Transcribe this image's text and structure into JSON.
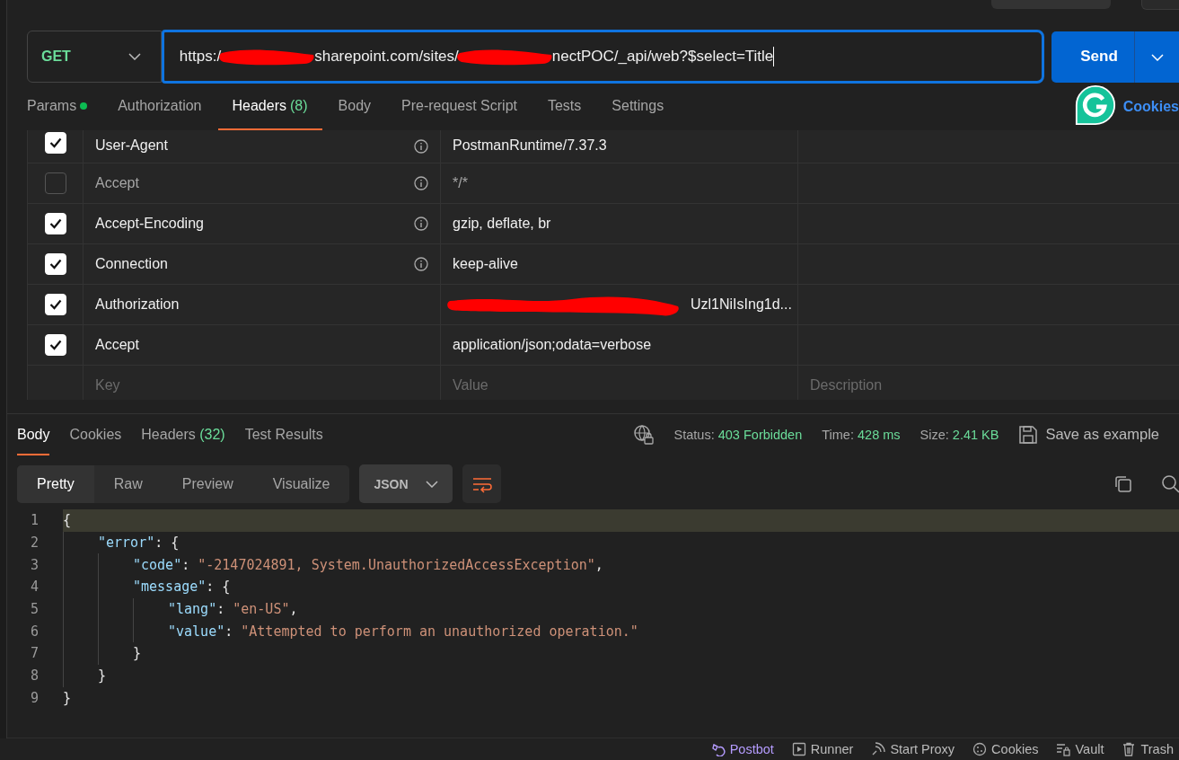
{
  "request": {
    "method": "GET",
    "url_parts": [
      {
        "kind": "text",
        "text": "https:/"
      },
      {
        "kind": "redacted"
      },
      {
        "kind": "text",
        "text": "sharepoint.com/sites/"
      },
      {
        "kind": "redacted"
      },
      {
        "kind": "text",
        "text": "nectPOC/_api/web?$select=Title"
      }
    ],
    "send_label": "Send"
  },
  "request_tabs": [
    {
      "label": "Params",
      "dot": true,
      "selected": false
    },
    {
      "label": "Authorization",
      "dot": false,
      "selected": false
    },
    {
      "label": "Headers",
      "count": "(8)",
      "dot": false,
      "selected": true
    },
    {
      "label": "Body",
      "dot": false,
      "selected": false
    },
    {
      "label": "Pre-request Script",
      "dot": false,
      "selected": false
    },
    {
      "label": "Tests",
      "dot": false,
      "selected": false
    },
    {
      "label": "Settings",
      "dot": false,
      "selected": false
    }
  ],
  "cookies_link": "Cookies",
  "headers": [
    {
      "checked": true,
      "key": "User-Agent",
      "info": true,
      "value": "PostmanRuntime/7.37.3",
      "redacted": false
    },
    {
      "checked": false,
      "key": "Accept",
      "info": true,
      "value": "*/*",
      "redacted": false
    },
    {
      "checked": true,
      "key": "Accept-Encoding",
      "info": true,
      "value": "gzip, deflate, br",
      "redacted": false
    },
    {
      "checked": true,
      "key": "Connection",
      "info": true,
      "value": "keep-alive",
      "redacted": false
    },
    {
      "checked": true,
      "key": "Authorization",
      "info": false,
      "value": "Uzl1NiIsIng1d...",
      "redacted": true
    },
    {
      "checked": true,
      "key": "Accept",
      "info": false,
      "value": "application/json;odata=verbose",
      "redacted": false
    }
  ],
  "new_header": {
    "key_placeholder": "Key",
    "value_placeholder": "Value",
    "description_placeholder": "Description"
  },
  "response_tabs": [
    {
      "label": "Body",
      "selected": true
    },
    {
      "label": "Cookies",
      "selected": false
    },
    {
      "label": "Headers",
      "count": "(32)",
      "selected": false
    },
    {
      "label": "Test Results",
      "selected": false
    }
  ],
  "response_meta": [
    {
      "label": "Status:",
      "value": "403 Forbidden"
    },
    {
      "label": "Time:",
      "value": "428 ms"
    },
    {
      "label": "Size:",
      "value": "2.41 KB"
    }
  ],
  "save_example": "Save as example",
  "view_modes": [
    {
      "label": "Pretty",
      "selected": true
    },
    {
      "label": "Raw",
      "selected": false
    },
    {
      "label": "Preview",
      "selected": false
    },
    {
      "label": "Visualize",
      "selected": false
    }
  ],
  "format": "JSON",
  "code_lines": [
    {
      "num": "1",
      "highlighted": true,
      "tokens": [
        {
          "kind": "punct",
          "text": "{"
        }
      ],
      "children": [
        {
          "num": "2",
          "highlighted": false,
          "tokens": [
            {
              "kind": "key",
              "text": "\"error\""
            },
            {
              "kind": "punct",
              "text": ": {"
            }
          ],
          "children": [
            {
              "num": "3",
              "highlighted": false,
              "tokens": [
                {
                  "kind": "key",
                  "text": "\"code\""
                },
                {
                  "kind": "punct",
                  "text": ": "
                },
                {
                  "kind": "string",
                  "text": "\"-2147024891, System.UnauthorizedAccessException\""
                },
                {
                  "kind": "punct",
                  "text": ","
                }
              ]
            },
            {
              "num": "4",
              "highlighted": false,
              "tokens": [
                {
                  "kind": "key",
                  "text": "\"message\""
                },
                {
                  "kind": "punct",
                  "text": ": {"
                }
              ],
              "children": [
                {
                  "num": "5",
                  "highlighted": false,
                  "tokens": [
                    {
                      "kind": "key",
                      "text": "\"lang\""
                    },
                    {
                      "kind": "punct",
                      "text": ": "
                    },
                    {
                      "kind": "string",
                      "text": "\"en-US\""
                    },
                    {
                      "kind": "punct",
                      "text": ","
                    }
                  ]
                },
                {
                  "num": "6",
                  "highlighted": false,
                  "tokens": [
                    {
                      "kind": "key",
                      "text": "\"value\""
                    },
                    {
                      "kind": "punct",
                      "text": ": "
                    },
                    {
                      "kind": "string",
                      "text": "\"Attempted to perform an unauthorized operation.\""
                    }
                  ]
                }
              ]
            },
            {
              "num": "7",
              "highlighted": false,
              "tokens": [
                {
                  "kind": "punct",
                  "text": "}"
                }
              ]
            }
          ]
        },
        {
          "num": "8",
          "highlighted": false,
          "tokens": [
            {
              "kind": "punct",
              "text": "}"
            }
          ]
        }
      ]
    },
    {
      "num": "9",
      "highlighted": false,
      "tokens": [
        {
          "kind": "punct",
          "text": "}"
        }
      ]
    }
  ],
  "status_bar": [
    {
      "kind": "postbot",
      "label": "Postbot"
    },
    {
      "kind": "runner",
      "label": "Runner"
    },
    {
      "kind": "proxy",
      "label": "Start Proxy"
    },
    {
      "kind": "cookies",
      "label": "Cookies"
    },
    {
      "kind": "vault",
      "label": "Vault"
    },
    {
      "kind": "trash",
      "label": "Trash"
    }
  ]
}
